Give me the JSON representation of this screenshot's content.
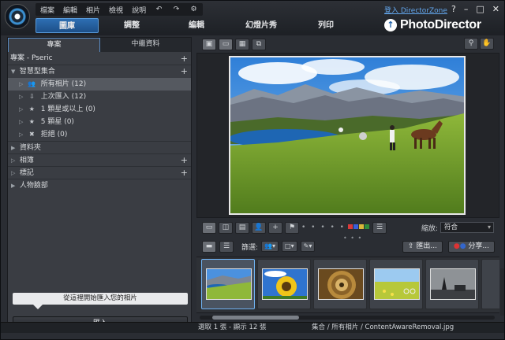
{
  "menu": {
    "items": [
      "檔案",
      "編輯",
      "相片",
      "檢視",
      "說明"
    ]
  },
  "modes": [
    {
      "label": "圖庫",
      "active": true
    },
    {
      "label": "調整",
      "active": false
    },
    {
      "label": "編輯",
      "active": false
    },
    {
      "label": "幻燈片秀",
      "active": false
    },
    {
      "label": "列印",
      "active": false
    }
  ],
  "header": {
    "directorzone": "登入 DirectorZone",
    "brand": "PhotoDirector",
    "win_help": "?",
    "win_min": "–",
    "win_max": "□",
    "win_close": "✕"
  },
  "left": {
    "tab_project": "專案",
    "tab_metadata": "中繼資料",
    "project_title": "專案 - Pseric",
    "smart_collections": "智慧型集合",
    "tree": [
      {
        "label": "所有相片 (12)",
        "selected": true,
        "icon": "people-icon"
      },
      {
        "label": "上次匯入 (12)",
        "selected": false,
        "icon": "import-icon"
      },
      {
        "label": "1 顆星或以上 (0)",
        "selected": false,
        "icon": "star-icon"
      },
      {
        "label": "5 顆星 (0)",
        "selected": false,
        "icon": "star-icon"
      },
      {
        "label": "拒絕 (0)",
        "selected": false,
        "icon": "reject-icon"
      }
    ],
    "folders": "資料夾",
    "albums": "相簿",
    "tags": "標記",
    "faces": "人物臉部",
    "drop_tip": "從這裡開始匯入您的相片",
    "import_button": "匯入"
  },
  "viewer": {
    "zoom_label": "縮放:",
    "zoom_value": "符合",
    "rating_dots": "• • • • •",
    "color_labels": [
      "#d93a3a",
      "#3a5fd9",
      "#d9b83a",
      "#2e8b3a"
    ]
  },
  "filmstrip": {
    "filter_label": "篩選:",
    "export_button": "匯出...",
    "share_button": "分享..."
  },
  "status": {
    "left": "選取 1 張 - 顯示 12 張",
    "right": "集合 / 所有相片 / ContentAwareRemoval.jpg"
  }
}
